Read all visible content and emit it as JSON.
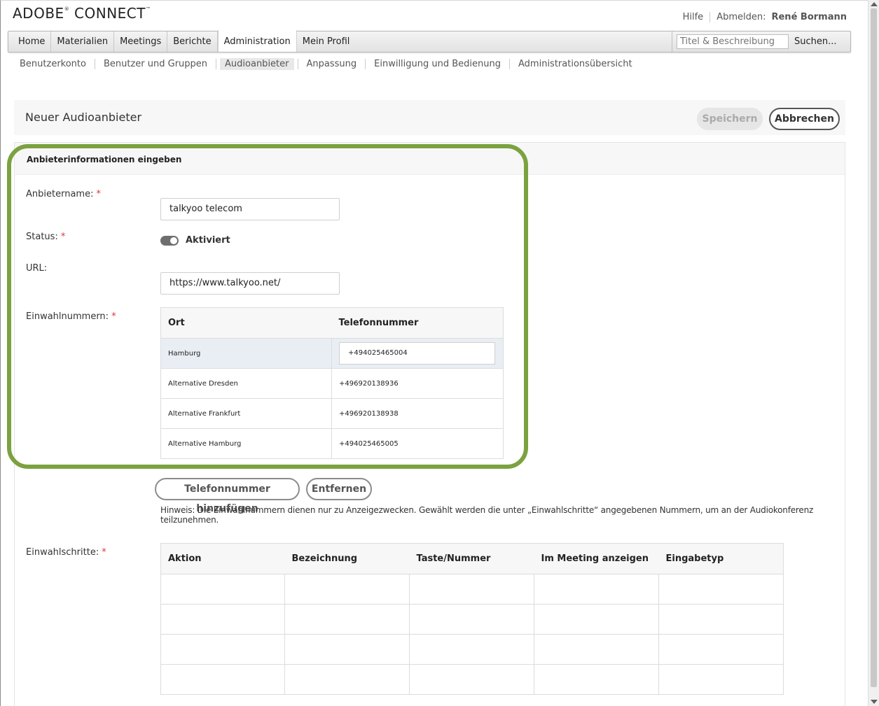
{
  "app": {
    "logo_text": "ADOBE",
    "logo_reg": "®",
    "logo_text2": " CONNECT",
    "logo_tm": "™"
  },
  "top_links": {
    "help": "Hilfe",
    "logout": "Abmelden:",
    "user": "René Bormann"
  },
  "main_nav": {
    "tabs": [
      {
        "label": "Home"
      },
      {
        "label": "Materialien"
      },
      {
        "label": "Meetings"
      },
      {
        "label": "Berichte"
      },
      {
        "label": "Administration"
      },
      {
        "label": "Mein Profil"
      }
    ],
    "active": "Administration",
    "search_placeholder": "Titel & Beschreibung",
    "search_button": "Suchen..."
  },
  "sub_nav": {
    "items": [
      {
        "label": "Benutzerkonto"
      },
      {
        "label": "Benutzer und Gruppen"
      },
      {
        "label": "Audioanbieter"
      },
      {
        "label": "Anpassung"
      },
      {
        "label": "Einwilligung und Bedienung"
      },
      {
        "label": "Administrationsübersicht"
      }
    ],
    "active": "Audioanbieter"
  },
  "page": {
    "title": "Neuer Audioanbieter",
    "save_label": "Speichern",
    "cancel_label": "Abbrechen"
  },
  "form": {
    "section_title": "Anbieterinformationen eingeben",
    "required_mark": "*",
    "provider_name_label": "Anbietername:",
    "provider_name_value": "talkyoo telecom",
    "status_label": "Status:",
    "status_value": "Aktiviert",
    "url_label": "URL:",
    "url_value": "https://www.talkyoo.net/",
    "dialin_label": "Einwahlnummern:",
    "dialin_table": {
      "headers": [
        "Ort",
        "Telefonnummer"
      ],
      "rows": [
        {
          "location": "Hamburg",
          "phone": "+494025465004"
        },
        {
          "location": "Alternative Dresden",
          "phone": "+496920138936"
        },
        {
          "location": "Alternative Frankfurt",
          "phone": "+496920138938"
        },
        {
          "location": "Alternative Hamburg",
          "phone": "+494025465005"
        }
      ]
    },
    "add_number_label": "Telefonnummer hinzufügen",
    "remove_label": "Entfernen",
    "hint": "Hinweis: Die Einwahlnummern dienen nur zu Anzeigezwecken. Gewählt werden die unter „Einwahlschritte“ angegebenen Nummern, um an der Audiokonferenz teilzunehmen.",
    "steps_label": "Einwahlschritte:",
    "steps_table": {
      "headers": [
        "Aktion",
        "Bezeichnung",
        "Taste/Nummer",
        "Im Meeting anzeigen",
        "Eingabetyp"
      ]
    }
  },
  "colors": {
    "highlight": "#7ba23f",
    "required": "#d7373f"
  }
}
